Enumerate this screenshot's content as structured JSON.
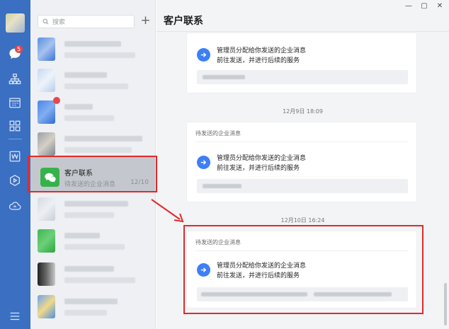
{
  "nav": {
    "unread_count": "5",
    "icons": [
      "chat-icon",
      "org-icon",
      "calendar-icon",
      "apps-icon",
      "doc-icon",
      "play-icon",
      "cloud-icon",
      "menu-icon"
    ]
  },
  "search": {
    "placeholder": "搜索"
  },
  "list": {
    "selected": {
      "title": "客户联系",
      "subtitle": "待发送的企业消息",
      "date": "12/10"
    }
  },
  "window": {
    "minimize": "—",
    "maximize": "▢",
    "close": "✕"
  },
  "main": {
    "title": "客户联系",
    "cards": [
      {
        "header": "",
        "line1": "管理员分配给你发送的企业消息",
        "line2": "前往发送，并进行后续的服务"
      },
      {
        "header": "待发送的企业消息",
        "line1": "管理员分配给你发送的企业消息",
        "line2": "前往发送，并进行后续的服务"
      },
      {
        "header": "待发送的企业消息",
        "line1": "管理员分配给你发送的企业消息",
        "line2": "前往发送，并进行后续的服务"
      }
    ],
    "timestamps": [
      "12月9日 18:09",
      "12月10日 16:24"
    ]
  },
  "colors": {
    "nav": "#3a6fc2",
    "accent": "#3d7ff5",
    "highlight": "#e02a2a",
    "wechat_green": "#36b24a"
  }
}
